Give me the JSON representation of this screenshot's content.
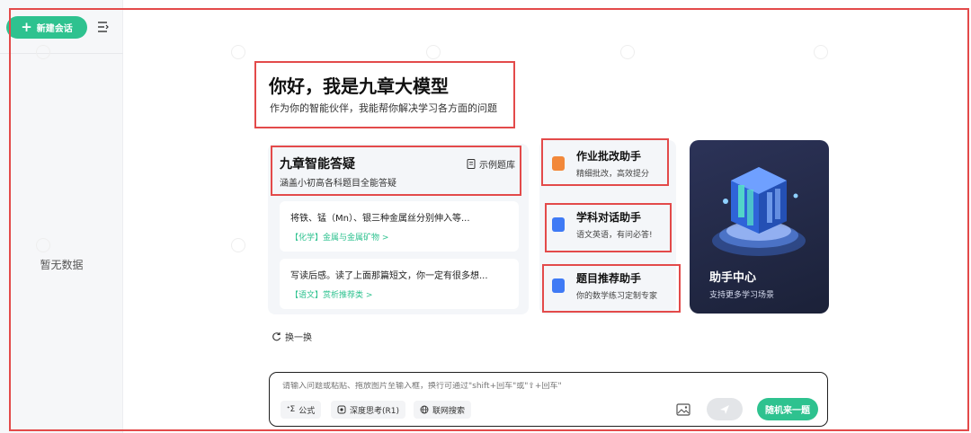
{
  "sidebar": {
    "new_chat_label": "新建会话",
    "empty_label": "暂无数据"
  },
  "hero": {
    "title": "你好，我是九章大模型",
    "subtitle": "作为你的智能伙伴，我能帮你解决学习各方面的问题"
  },
  "qa": {
    "title": "九章智能答疑",
    "description": "涵盖小初高各科题目全能答疑",
    "example_link": "示例题库",
    "cards": [
      {
        "question": "将铁、锰（Mn）、银三种金属丝分别伸入等...",
        "tag": "【化学】金属与金属矿物 >"
      },
      {
        "question": "写读后感。读了上面那篇短文，你一定有很多想...",
        "tag": "【语文】赏析推荐类 >"
      }
    ]
  },
  "assistants": [
    {
      "title": "作业批改助手",
      "description": "精细批改，高效提分",
      "icon": "homework-icon",
      "color": "#f2883a"
    },
    {
      "title": "学科对话助手",
      "description": "语文英语，有问必答!",
      "icon": "chat-quote-icon",
      "color": "#3f7af5"
    },
    {
      "title": "题目推荐助手",
      "description": "你的数学练习定制专家",
      "icon": "recommend-icon",
      "color": "#3f7af5"
    }
  ],
  "hub": {
    "title": "助手中心",
    "subtitle": "支持更多学习场景"
  },
  "refresh_label": "换一换",
  "input": {
    "placeholder": "请输入问题或粘贴、拖放图片至输入框，换行可通过\"shift+回车\"或\"⇧+回车\"",
    "tools": [
      {
        "label": "公式",
        "icon": "formula-icon"
      },
      {
        "label": "深度思考(R1)",
        "icon": "deep-think-icon"
      },
      {
        "label": "联网搜索",
        "icon": "globe-icon"
      }
    ],
    "random_label": "随机来一题"
  },
  "colors": {
    "accent": "#2ec28f",
    "annotation_red": "#e34a4a",
    "hub_bg": "#1b2138"
  }
}
